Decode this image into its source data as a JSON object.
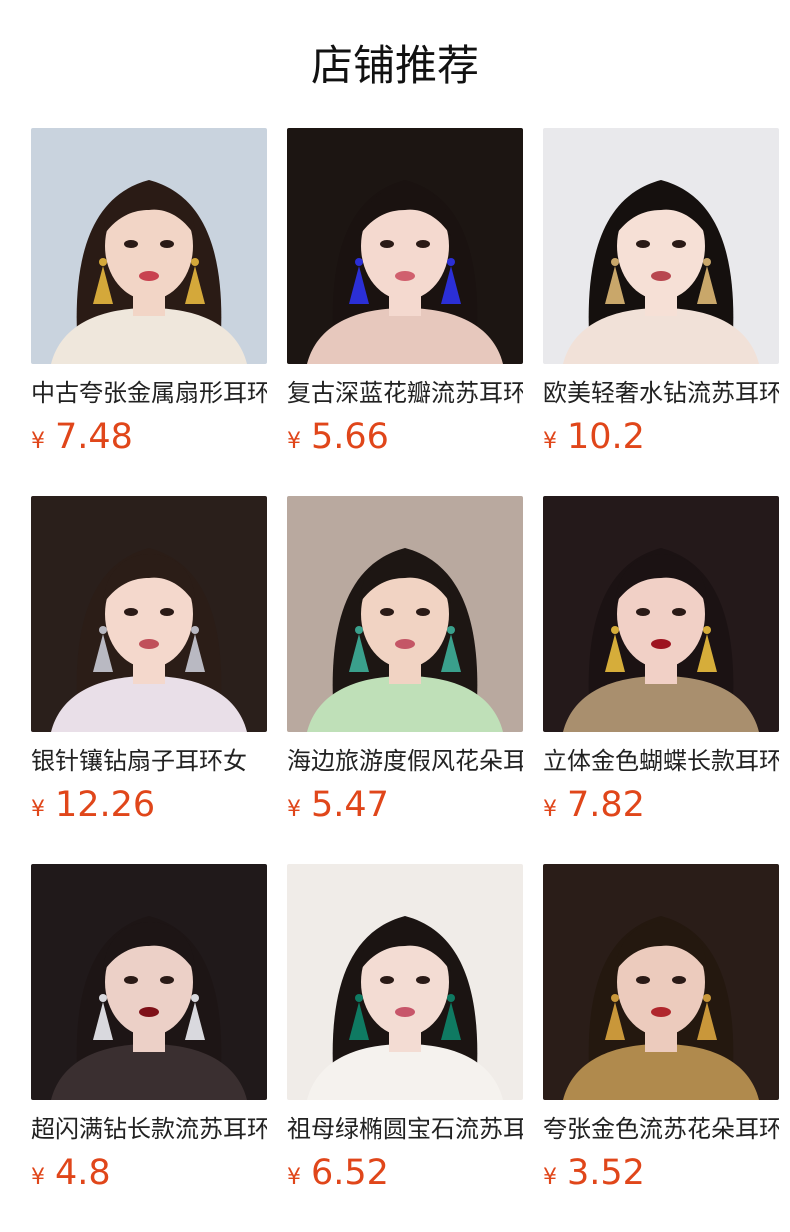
{
  "page": {
    "title": "店铺推荐"
  },
  "products": [
    {
      "name": "中古夸张金属扇形耳环",
      "currency": "¥",
      "price": "7.48",
      "bg": "#c9d3de",
      "hair": "#2a1b15",
      "skin": "#f2d5c6",
      "accent": "#d4a83a",
      "cloth": "#efe7dc",
      "lip": "#c8424f"
    },
    {
      "name": "复古深蓝花瓣流苏耳环",
      "currency": "¥",
      "price": "5.66",
      "bg": "#1c1512",
      "hair": "#1a1210",
      "skin": "#f4d9cf",
      "accent": "#2b2fd6",
      "cloth": "#e7c8bd",
      "lip": "#d0606e"
    },
    {
      "name": "欧美轻奢水钻流苏耳环",
      "currency": "¥",
      "price": "10.2",
      "bg": "#e9e9ec",
      "hair": "#15100e",
      "skin": "#f6e0d6",
      "accent": "#c9a76a",
      "cloth": "#f1e1d8",
      "lip": "#b8474f"
    },
    {
      "name": "银针镶钻扇子耳环女",
      "currency": "¥",
      "price": "12.26",
      "bg": "#2a1f1b",
      "hair": "#2b1d17",
      "skin": "#f4d8cc",
      "accent": "#b9b9c2",
      "cloth": "#e9dfe8",
      "lip": "#c0505a"
    },
    {
      "name": "海边旅游度假风花朵耳环",
      "currency": "¥",
      "price": "5.47",
      "bg": "#b9a99f",
      "hair": "#1d1613",
      "skin": "#f1d3c3",
      "accent": "#3aa08c",
      "cloth": "#bfe0b8",
      "lip": "#c45666"
    },
    {
      "name": "立体金色蝴蝶长款耳环",
      "currency": "¥",
      "price": "7.82",
      "bg": "#24191a",
      "hair": "#1b1213",
      "skin": "#f1d0c6",
      "accent": "#d6ad3a",
      "cloth": "#a98f6e",
      "lip": "#9e1420"
    },
    {
      "name": "超闪满钻长款流苏耳环",
      "currency": "¥",
      "price": "4.8",
      "bg": "#20191a",
      "hair": "#1d1515",
      "skin": "#ecd0c7",
      "accent": "#d9d9de",
      "cloth": "#3a2f30",
      "lip": "#7e1018"
    },
    {
      "name": "祖母绿椭圆宝石流苏耳环",
      "currency": "¥",
      "price": "6.52",
      "bg": "#f0ece8",
      "hair": "#1b1412",
      "skin": "#f3dcd3",
      "accent": "#0f7a62",
      "cloth": "#f5f2ee",
      "lip": "#c7566a"
    },
    {
      "name": "夸张金色流苏花朵耳环",
      "currency": "¥",
      "price": "3.52",
      "bg": "#2a1d18",
      "hair": "#24180f",
      "skin": "#eccbbd",
      "accent": "#c9973a",
      "cloth": "#b08a4d",
      "lip": "#b0262c"
    }
  ]
}
